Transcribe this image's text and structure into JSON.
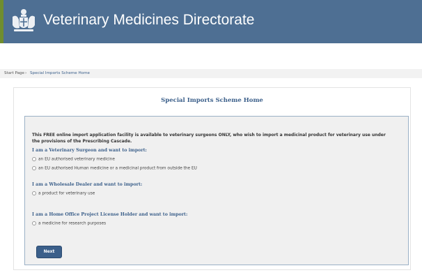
{
  "header": {
    "title": "Veterinary Medicines Directorate",
    "background_color": "#4e6f93"
  },
  "breadcrumb": {
    "items": [
      "Start Page",
      "Special Imports Scheme Home"
    ],
    "separator": "›"
  },
  "main": {
    "title": "Special Imports Scheme Home",
    "intro": "This FREE online import application facility is available to veterinary surgeons ONLY, who wish to import a medicinal product for veterinary use under the provisions of the Prescribing Cascade.",
    "sections": [
      {
        "heading": "I am a Veterinary Surgeon and want to import:",
        "options": [
          "an EU authorised veterinary medicine",
          "an EU authorised Human medicine or a medicinal product from outside the EU"
        ]
      },
      {
        "heading": "I am a Wholesale Dealer and want to import:",
        "options": [
          "a product for veterinary use"
        ]
      },
      {
        "heading": "I am a Home Office Project License Holder and want to import:",
        "options": [
          "a medicine for research purposes"
        ]
      }
    ],
    "next_label": "Next"
  }
}
